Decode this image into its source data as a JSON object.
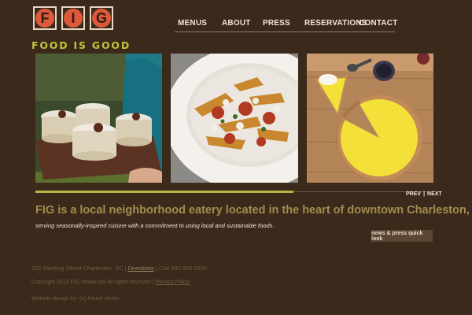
{
  "brand": {
    "logo_letters": [
      "F",
      "I",
      "G"
    ],
    "tagline": "FOOD IS GOOD",
    "colors": {
      "tile": "#e0583b",
      "tagline": "#c3c13c",
      "background": "#3b2a1b"
    }
  },
  "nav": {
    "items": [
      {
        "label": "MENUS"
      },
      {
        "label": "ABOUT"
      },
      {
        "label": "PRESS"
      },
      {
        "label": "RESERVATIONS"
      },
      {
        "label": "CONTACT"
      }
    ]
  },
  "slider": {
    "prev_label": "PREV",
    "separator": "|",
    "next_label": "NEXT",
    "photos": [
      {
        "name": "dessert-glasses-photo"
      },
      {
        "name": "pasta-dish-photo"
      },
      {
        "name": "lemon-tart-photo"
      }
    ]
  },
  "intro": {
    "headline": "FIG is a local neighborhood eatery located in the heart of downtown Charleston,",
    "subline": "serving seasonally-inspired cuisine with a commitment to using local and sustainable foods.",
    "quick_look_button": "news & press quick look"
  },
  "footer": {
    "address": "232 Meeting Street Charleston, SC",
    "sep1": "|",
    "directions_link": "Directions",
    "sep2": "|",
    "phone": "Call 843.805.5900",
    "copyright": "Copyright 2013 FIG restaurant All rights reserved",
    "sep3": "|",
    "privacy_link": "Privacy Policy",
    "design_credit": "Website design by: (e) house studio"
  }
}
